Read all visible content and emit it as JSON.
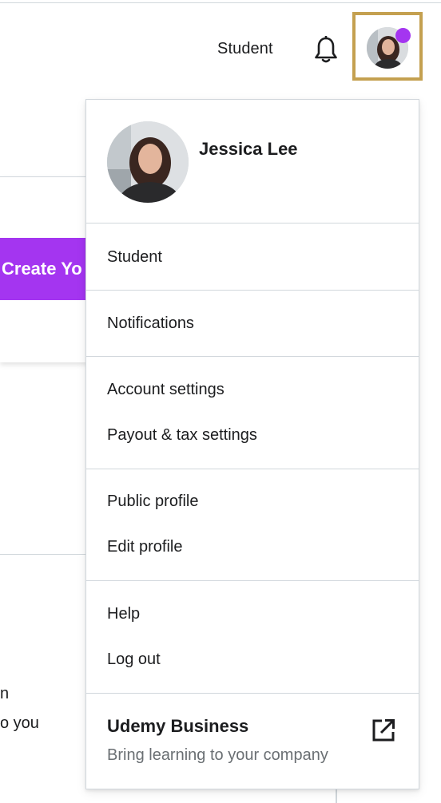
{
  "header": {
    "student_link": "Student",
    "bell_icon": "bell-icon",
    "avatar_badge_color": "#a435f0"
  },
  "background": {
    "create_button_label": "Create Yo",
    "text_line_1": "n",
    "text_line_2": "o you"
  },
  "dropdown": {
    "user_name": "Jessica Lee",
    "sections": [
      [
        "Student"
      ],
      [
        "Notifications"
      ],
      [
        "Account settings",
        "Payout & tax settings"
      ],
      [
        "Public profile",
        "Edit profile"
      ],
      [
        "Help",
        "Log out"
      ]
    ],
    "business": {
      "title": "Udemy Business",
      "subtitle": "Bring learning to your company",
      "icon": "external-link-icon"
    }
  },
  "colors": {
    "accent": "#a435f0",
    "highlight_frame": "#c4a050",
    "text_primary": "#1c1d1f",
    "text_muted": "#6a6f73",
    "border": "#d1d7dc"
  }
}
